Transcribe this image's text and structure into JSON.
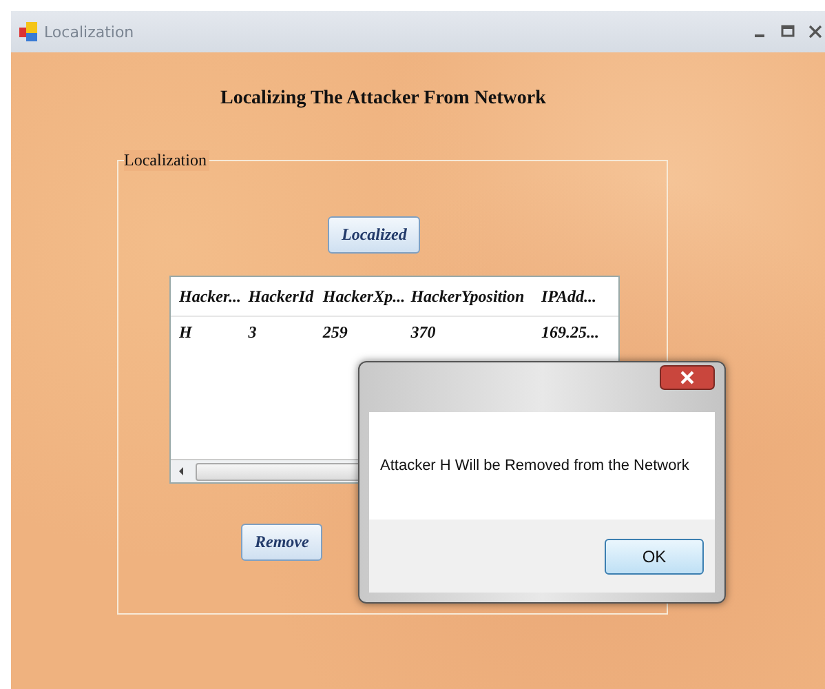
{
  "window": {
    "title": "Localization"
  },
  "heading": "Localizing The Attacker From Network",
  "group": {
    "label": "Localization"
  },
  "localize_button": "Localized",
  "table": {
    "columns": [
      "Hacker...",
      "HackerId",
      "HackerXp...",
      "HackerYposition",
      "IPAdd..."
    ],
    "rows": [
      [
        "H",
        "3",
        "259",
        "370",
        "169.25..."
      ]
    ]
  },
  "remove_button": "Remove",
  "dialog": {
    "message": "Attacker H Will be Removed from the Network",
    "button": "OK"
  }
}
